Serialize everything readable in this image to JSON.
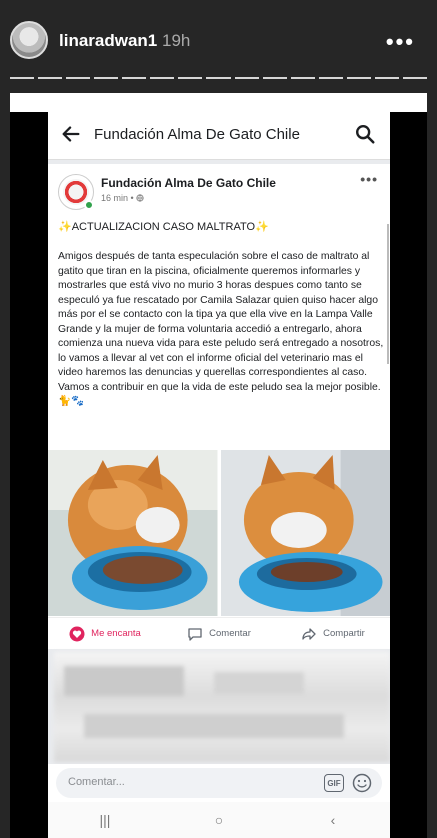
{
  "story": {
    "username": "linaradwan1",
    "time_ago": "19h",
    "more_glyph": "•••",
    "progress_segments": 15
  },
  "fb": {
    "page_title": "Fundación Alma De Gato Chile",
    "back_icon": "arrow-left-icon",
    "search_icon": "search-icon"
  },
  "post": {
    "author": "Fundación Alma De Gato Chile",
    "meta": "16 min • ",
    "more_glyph": "•••",
    "heading": "✨ACTUALIZACION CASO MALTRATO✨",
    "body": "Amigos después de tanta especulación sobre el caso de maltrato al gatito que tiran en la piscina, oficialmente queremos informarles y mostrarles que está vivo no murio 3 horas despues como tanto se especuló ya fue rescatado por Camila Salazar quien quiso hacer algo más por el se contacto con la tipa ya que ella vive en la Lampa Valle Grande y la mujer de forma voluntaria accedió a entregarlo, ahora comienza una nueva vida para este peludo será entregado a nosotros, lo vamos a llevar al vet con el informe oficial del veterinario mas el video haremos las denuncias y querellas correspondientes al caso. Vamos a contribuir en que la vida de este peludo sea la mejor posible. 🐈🐾",
    "actions": {
      "like": "Me encanta",
      "comment": "Comentar",
      "share": "Compartir"
    }
  },
  "comment_bar": {
    "placeholder": "Comentar...",
    "gif_label": "GIF"
  },
  "android_nav": {
    "recent": "|||",
    "home": "○",
    "back": "‹"
  },
  "colors": {
    "like": "#e0245e",
    "story_bg": "#262626"
  }
}
